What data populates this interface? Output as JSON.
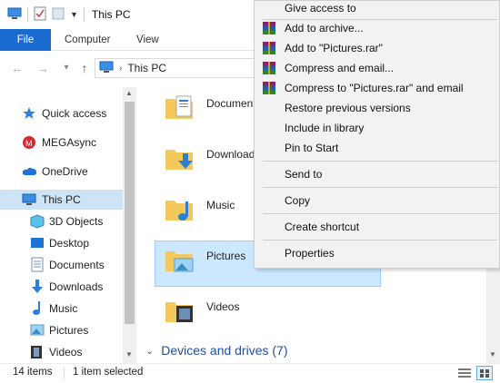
{
  "window": {
    "title": "This PC"
  },
  "ribbon": {
    "tabs": [
      "File",
      "Computer",
      "View"
    ]
  },
  "address": {
    "path": "This PC"
  },
  "sidebar": {
    "items": [
      {
        "label": "Quick access",
        "icon": "star-icon"
      },
      {
        "label": "MEGAsync",
        "icon": "mega-icon"
      },
      {
        "label": "OneDrive",
        "icon": "cloud-icon"
      },
      {
        "label": "This PC",
        "icon": "computer-icon"
      },
      {
        "label": "3D Objects",
        "icon": "cube-icon"
      },
      {
        "label": "Desktop",
        "icon": "desktop-icon"
      },
      {
        "label": "Documents",
        "icon": "document-icon"
      },
      {
        "label": "Downloads",
        "icon": "download-arrow-icon"
      },
      {
        "label": "Music",
        "icon": "music-note-icon"
      },
      {
        "label": "Pictures",
        "icon": "picture-icon"
      },
      {
        "label": "Videos",
        "icon": "film-icon"
      }
    ]
  },
  "content": {
    "folders": [
      "Documents",
      "Downloads",
      "Music",
      "Pictures",
      "Videos"
    ],
    "section": "Devices and drives (7)"
  },
  "status": {
    "items": "14 items",
    "selected": "1 item selected"
  },
  "context_menu": {
    "items": [
      {
        "label": "Give access to",
        "rar": false
      },
      {
        "label": "Add to archive...",
        "rar": true
      },
      {
        "label": "Add to \"Pictures.rar\"",
        "rar": true
      },
      {
        "label": "Compress and email...",
        "rar": true
      },
      {
        "label": "Compress to \"Pictures.rar\" and email",
        "rar": true
      },
      {
        "label": "Restore previous versions",
        "rar": false
      },
      {
        "label": "Include in library",
        "rar": false
      },
      {
        "label": "Pin to Start",
        "rar": false
      },
      {
        "label": "Send to",
        "rar": false
      },
      {
        "label": "Copy",
        "rar": false
      },
      {
        "label": "Create shortcut",
        "rar": false
      },
      {
        "label": "Properties",
        "rar": false
      }
    ]
  },
  "colors": {
    "accent": "#1a6bd1",
    "selection": "#cce8ff",
    "folder": "#f3c85d"
  }
}
